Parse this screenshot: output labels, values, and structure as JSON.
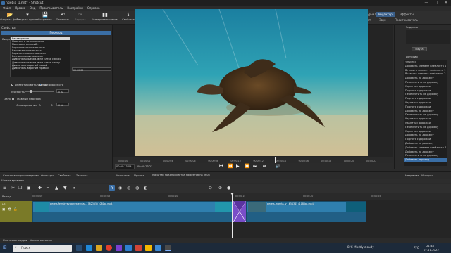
{
  "window": {
    "title": "ngebia_1.mlt* - Shotcut",
    "controls": [
      "—",
      "□",
      "✕"
    ]
  },
  "menu": [
    "Файл",
    "Правка",
    "Вид",
    "Проигрыватель",
    "Настройки",
    "Справка"
  ],
  "toolbar": [
    {
      "label": "Открыть файл",
      "icon": "folder-open-icon",
      "glyph": "📂",
      "enabled": true
    },
    {
      "label": "Открыть прочее",
      "icon": "open-other-icon",
      "glyph": "▾",
      "enabled": true
    },
    {
      "label": "Сохранить",
      "icon": "save-icon",
      "glyph": "💾",
      "enabled": true
    },
    {
      "label": "Отменить",
      "icon": "undo-icon",
      "glyph": "↶",
      "enabled": true
    },
    {
      "label": "Вернуть",
      "icon": "redo-icon",
      "glyph": "↷",
      "enabled": false
    },
    {
      "label": "Измеритель пиков",
      "icon": "peak-meter-icon",
      "glyph": "▮▮",
      "enabled": true
    },
    {
      "label": "Свойства",
      "icon": "properties-icon",
      "glyph": "ℹ",
      "enabled": true
    },
    {
      "label": "Недавние",
      "icon": "recent-icon",
      "glyph": "🕑",
      "enabled": true
    },
    {
      "label": "Заметки",
      "icon": "notes-icon",
      "glyph": "✎",
      "enabled": true
    },
    {
      "label": "Список воспроизведения",
      "icon": "playlist-icon",
      "glyph": "☰",
      "enabled": true
    },
    {
      "label": "Шкала времени",
      "icon": "timeline-icon",
      "glyph": "▤",
      "enabled": true
    },
    {
      "label": "Фильтры",
      "icon": "filter-icon",
      "glyph": "⏷",
      "enabled": true
    },
    {
      "label": "Метки",
      "icon": "markers-icon",
      "glyph": "◆",
      "enabled": true
    },
    {
      "label": "Ключевые кадры",
      "icon": "keyframes-icon",
      "glyph": "◇",
      "enabled": true
    },
    {
      "label": "История",
      "icon": "history-icon",
      "glyph": "↺",
      "enabled": true
    },
    {
      "label": "Экспорт",
      "icon": "export-icon",
      "glyph": "⬤",
      "enabled": true
    },
    {
      "label": "Задания",
      "icon": "jobs-icon",
      "glyph": "⚙",
      "enabled": true
    }
  ],
  "layouts": {
    "tabs": [
      "Журнал",
      "Редактор",
      "Эффекты"
    ],
    "selected": "Редактор",
    "sub": [
      "Цвет",
      "Звук",
      "Проигрыватель"
    ]
  },
  "properties": {
    "title": "Свойства",
    "panel_header": "Переход",
    "video_label": "Видео",
    "transition_types": [
      "Растворение",
      "Нарезка с затемнением",
      "Пользовательский...",
      "Горизонтальные полосы",
      "Вертикальные полосы",
      "Горизонтальные жалюзи",
      "Вертикальные жалюзи",
      "Диагональные жалюзи слева сверху",
      "Диагональные жалюзи слева снизу",
      "Диагональ верхний левый",
      "Диагональ верхний правый"
    ],
    "selected_transition": "Растворение",
    "duration_value": "00:00:00",
    "invert_label": "Инвертировать чистки",
    "preview_label": "Предпросмотр",
    "softness_label": "Мягкость",
    "softness_value": "0 %",
    "audio_label": "Звук",
    "crossfade_label": "Плавный переход",
    "mix_label": "Микширование",
    "mix_value": "0 %",
    "link_text": "Получить больше переходов"
  },
  "left_tabs": [
    "Список воспроизведения",
    "Фильтры",
    "Свойства",
    "Экспорт"
  ],
  "player": {
    "timecode": "00:00:13:09",
    "duration": "00:00:23:23",
    "ruler_ticks": [
      "00:00:00",
      "00:00:02",
      "00:00:04",
      "00:00:06",
      "00:00:08",
      "00:00:10",
      "00:00:12",
      "00:00:14",
      "00:00:16",
      "00:00:18",
      "00:00:20",
      "00:00:22"
    ],
    "transport": [
      "⏮",
      "⏪",
      "▶",
      "⏩",
      "⏭",
      "⏯"
    ],
    "zoom": "---",
    "volume_icon": "🔊",
    "tabs": [
      "Источник",
      "Проект"
    ],
    "scale_text": "Масштаб предпросмотра эффектов на 360p"
  },
  "history": {
    "title": "История",
    "tabs_top": [
      "Задания"
    ],
    "pause_label": "Пауза",
    "items": [
      "<пусто>",
      "Добавить элемент плейлиста 1",
      "Вставить элемент плейлиста 1",
      "Вставить элемент плейлиста 2",
      "Добавить на дорожку",
      "Переместить на дорожку",
      "Удалить с дорожки",
      "Поднять с дорожки",
      "Переместить на дорожку",
      "Поднять с дорожки",
      "Удалить с дорожки",
      "Поднять с дорожки",
      "Добавить на дорожку",
      "Переместить на дорожку",
      "Удалить с дорожки",
      "Удалить с дорожки",
      "Переместить на дорожку",
      "Удалить с дорожки",
      "Добавить на дорожку",
      "Поднять с дорожки",
      "Добавить на дорожку",
      "Добавить элемент плейлиста 4",
      "Добавить на дорожку",
      "Переместить на дорожку",
      "Добавить переход"
    ],
    "selected": "Добавить переход",
    "bottom_tabs": [
      "Недавние",
      "История"
    ]
  },
  "timeline": {
    "title": "Шкала времени",
    "output_label": "Выход",
    "track_name": "V1",
    "ruler": [
      "00:00:00",
      "00:00:05",
      "00:00:10",
      "00:00:15",
      "00:00:20",
      "00:00:25"
    ],
    "clip1_label": "pexels-ferminrev-gonzalezdiaz-1782305 (1080p).mp4",
    "clip2_label": "pexels-mamta-jy 1654345 (1080p).mp4",
    "bottom_tabs": [
      "Ключевые кадры",
      "Шкала времени"
    ]
  },
  "taskbar": {
    "search_placeholder": "Поиск",
    "weather": "8°C  Mostly cloudy",
    "lang": "РУС",
    "time": "21:48",
    "date": "07.11.2022"
  },
  "colors": {
    "accent": "#3a6ea5",
    "track_header": "#7a7a28",
    "clip": "#2f7fae",
    "transition": "#7a4ec8"
  }
}
